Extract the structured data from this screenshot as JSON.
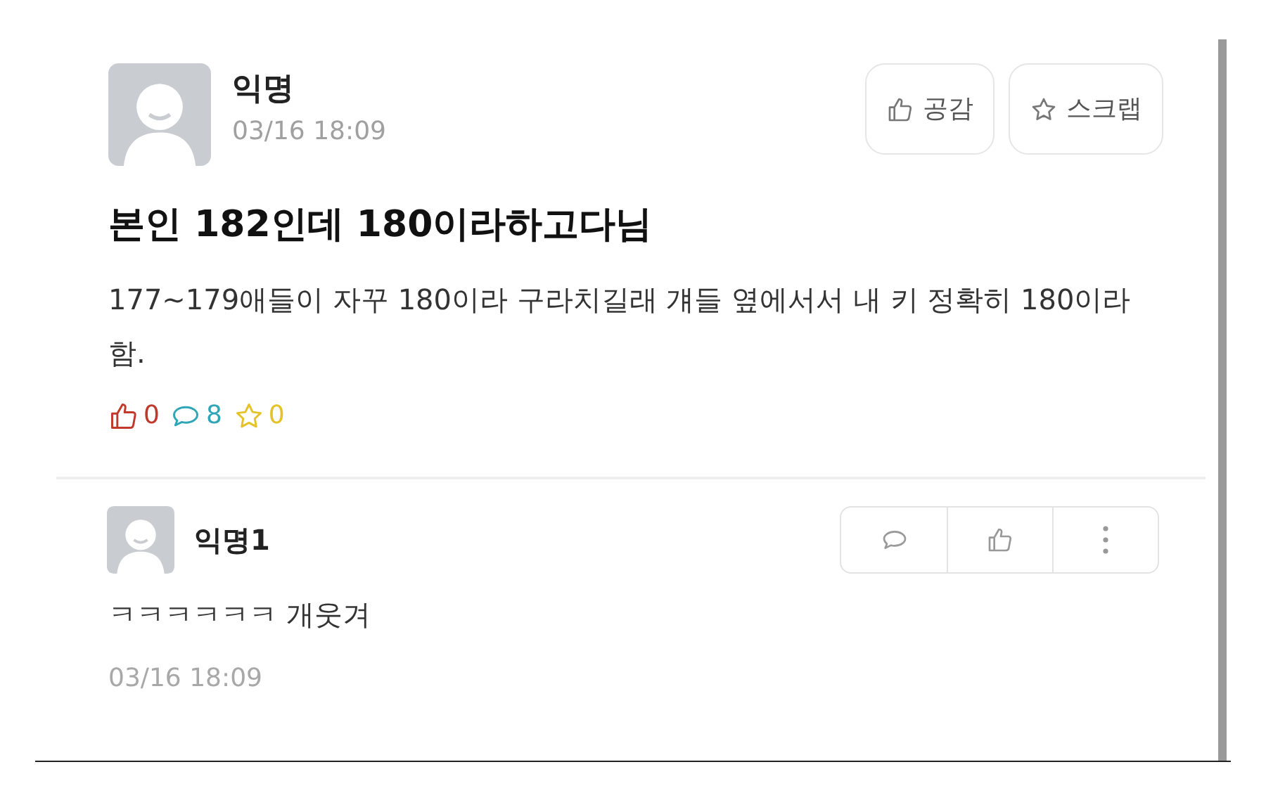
{
  "post": {
    "author": "익명",
    "time": "03/16 18:09",
    "actions": [
      {
        "kind": "like",
        "label": "공감"
      },
      {
        "kind": "scrap",
        "label": "스크랩"
      }
    ],
    "title": "본인 **182**인데 **180**이라하고다님",
    "body": "177~179애들이 자꾸 180이라 구라치길래 걔들 옆에서서 내 키 정확히 180이라함.",
    "stats": [
      {
        "kind": "like",
        "count": "0",
        "color": "#c0392b"
      },
      {
        "kind": "comment",
        "count": "8",
        "color": "#2fa6b8"
      },
      {
        "kind": "scrap",
        "count": "0",
        "color": "#e6c229"
      }
    ]
  },
  "comments": [
    {
      "author": "익명1",
      "text": "ㅋㅋㅋㅋㅋㅋ 개웃겨",
      "time": "03/16 18:09",
      "actions": [
        {
          "kind": "reply"
        },
        {
          "kind": "like"
        },
        {
          "kind": "more"
        }
      ]
    }
  ]
}
